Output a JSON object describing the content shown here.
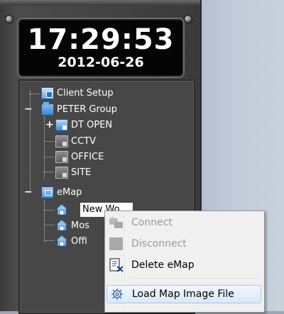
{
  "clock": {
    "time": "17:29:53",
    "date": "2012-06-26"
  },
  "tree": {
    "client_setup": "Client Setup",
    "group": "PETER Group",
    "dt_open": "DT OPEN",
    "cctv": "CCTV",
    "office": "OFFICE",
    "site": "SITE",
    "emap": "eMap",
    "emap_children": [
      "New Wo",
      "Mos",
      "Offi"
    ],
    "collapse_symbol": "−",
    "expand_symbol": "+"
  },
  "context_menu": {
    "items": [
      {
        "label": "Connect",
        "icon": "connect-icon",
        "enabled": false
      },
      {
        "label": "Disconnect",
        "icon": "disconnect-icon",
        "enabled": false
      },
      {
        "label": "Delete eMap",
        "icon": "delete-document-icon",
        "enabled": true
      },
      {
        "label": "Load Map Image File",
        "icon": "gear-icon",
        "enabled": true,
        "highlighted": true
      }
    ]
  },
  "colors": {
    "panel": "#444444",
    "clock_background": "#050505",
    "menu_background": "#f0f0f0",
    "menu_highlight": "#dbe8f8",
    "disabled_text": "#9a9a9a"
  }
}
